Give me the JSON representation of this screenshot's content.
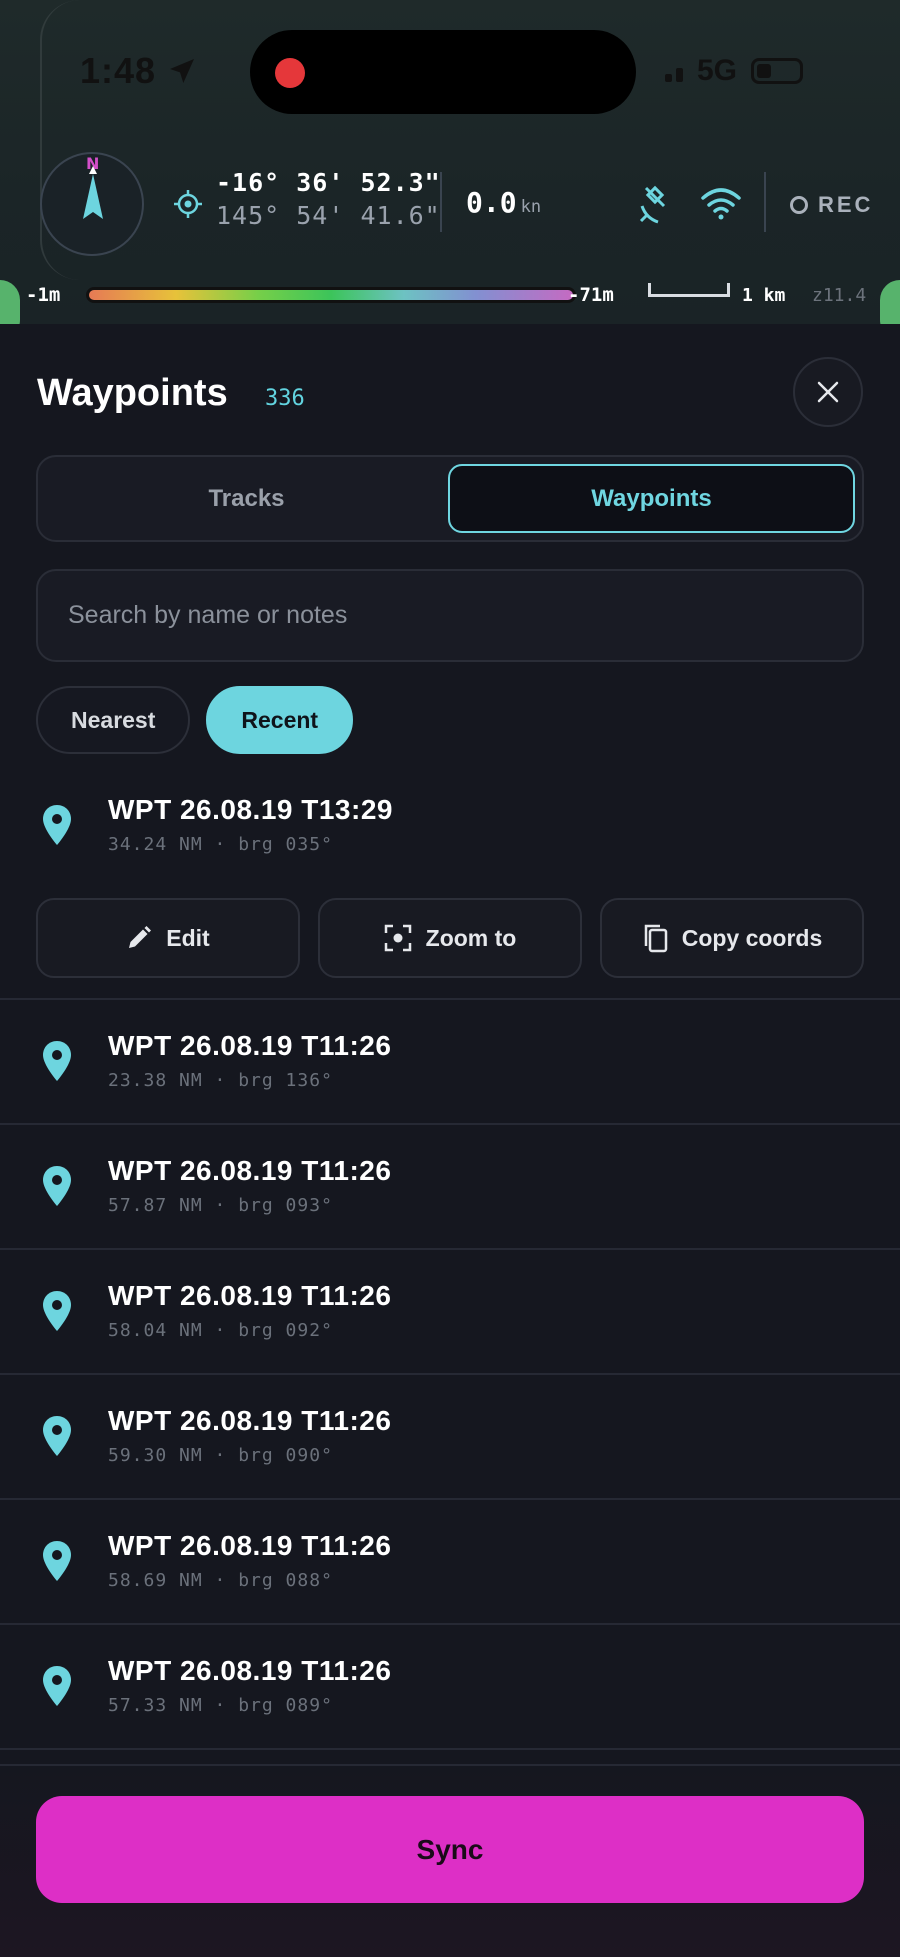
{
  "status_bar": {
    "time": "1:48",
    "network": "5G"
  },
  "nav": {
    "compass_label": "N",
    "lat": "-16° 36' 52.3\"",
    "lon": "145° 54' 41.6\"",
    "speed_value": "0.0",
    "speed_unit": "kn",
    "rec_label": "REC",
    "depth_min": "-1m",
    "depth_max": "-71m",
    "scale_label": "1 km",
    "zoom_label": "z11.4"
  },
  "sheet": {
    "title": "Waypoints",
    "count": "336",
    "tabs": [
      {
        "label": "Tracks",
        "active": false
      },
      {
        "label": "Waypoints",
        "active": true
      }
    ],
    "search_placeholder": "Search by name or notes",
    "sort_chips": [
      {
        "label": "Nearest",
        "active": false
      },
      {
        "label": "Recent",
        "active": true
      }
    ],
    "waypoints": [
      {
        "name": "WPT 26.08.19 T13:29",
        "meta": "34.24 NM · brg 035°"
      },
      {
        "name": "WPT 26.08.19 T11:26",
        "meta": "23.38 NM · brg 136°"
      },
      {
        "name": "WPT 26.08.19 T11:26",
        "meta": "57.87 NM · brg 093°"
      },
      {
        "name": "WPT 26.08.19 T11:26",
        "meta": "58.04 NM · brg 092°"
      },
      {
        "name": "WPT 26.08.19 T11:26",
        "meta": "59.30 NM · brg 090°"
      },
      {
        "name": "WPT 26.08.19 T11:26",
        "meta": "58.69 NM · brg 088°"
      },
      {
        "name": "WPT 26.08.19 T11:26",
        "meta": "57.33 NM · brg 089°"
      }
    ],
    "actions": {
      "edit": "Edit",
      "zoom": "Zoom to",
      "copy": "Copy coords"
    },
    "sync_label": "Sync"
  },
  "colors": {
    "accent": "#6dd5df",
    "sync": "#dd2fc6",
    "background": "#15171f"
  }
}
